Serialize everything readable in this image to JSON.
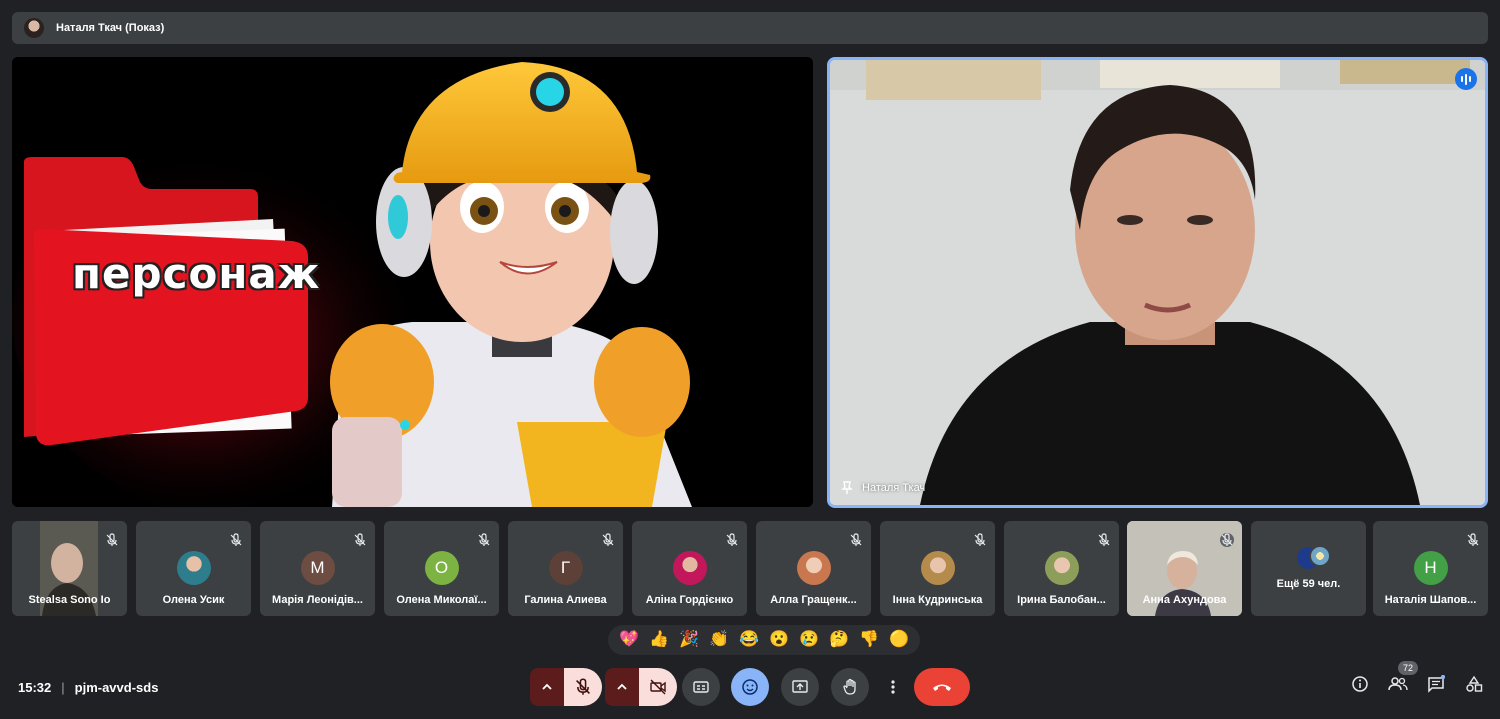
{
  "header": {
    "presenter_label": "Наталя Ткач (Показ)"
  },
  "presentation": {
    "slide_text": "персонаж"
  },
  "speaker": {
    "name": "Наталя Ткач"
  },
  "participants": [
    {
      "name": "Stealsa Sono Io",
      "kind": "video"
    },
    {
      "name": "Олена Усик",
      "kind": "photo",
      "color": "#2e7d8c"
    },
    {
      "name": "Марія Леонідів...",
      "kind": "letter",
      "letter": "М",
      "color": "#6d4c41"
    },
    {
      "name": "Олена Миколаї...",
      "kind": "letter",
      "letter": "О",
      "color": "#7cb342"
    },
    {
      "name": "Галина Алиева",
      "kind": "letter",
      "letter": "Г",
      "color": "#5d4037"
    },
    {
      "name": "Аліна Гордієнко",
      "kind": "photo",
      "color": "#c2185b"
    },
    {
      "name": "Алла Гращенк...",
      "kind": "photo",
      "color": "#d7a98a"
    },
    {
      "name": "Інна Кудринська",
      "kind": "photo",
      "color": "#b58b4c"
    },
    {
      "name": "Ірина Балобан...",
      "kind": "photo",
      "color": "#8d9e5a"
    },
    {
      "name": "Анна Ахундова",
      "kind": "video"
    },
    {
      "name": "Ещё 59 чел.",
      "kind": "more"
    },
    {
      "name": "Наталія Шапов...",
      "kind": "letter",
      "letter": "Н",
      "color": "#43a047"
    }
  ],
  "reactions": [
    "💖",
    "👍",
    "🎉",
    "👏",
    "😂",
    "😮",
    "😢",
    "🤔",
    "👎",
    "🟡"
  ],
  "footer": {
    "time": "15:32",
    "separator": "|",
    "meeting_code": "pjm-avvd-sds",
    "participants_count": "72"
  },
  "colors": {
    "end_call": "#ea4335",
    "muted_bg": "#f9dedc",
    "emoji_active": "#8ab4f8"
  }
}
